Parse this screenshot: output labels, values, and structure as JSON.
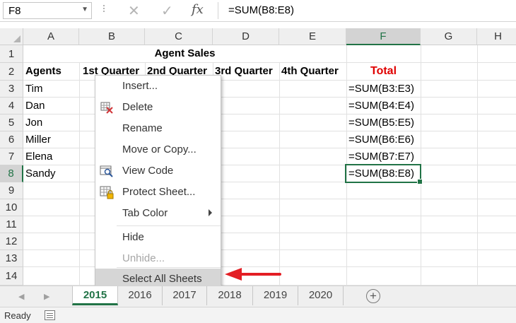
{
  "name_box": {
    "value": "F8"
  },
  "formula_bar": {
    "formula": "=SUM(B8:E8)",
    "fx_label": "fx",
    "cancel_glyph": "✕",
    "enter_glyph": "✓"
  },
  "columns": [
    "A",
    "B",
    "C",
    "D",
    "E",
    "F",
    "G",
    "H"
  ],
  "rows": [
    "1",
    "2",
    "3",
    "4",
    "5",
    "6",
    "7",
    "8",
    "9",
    "10",
    "11",
    "12",
    "13",
    "14"
  ],
  "cells": {
    "title": "Agent Sales",
    "headers": [
      "Agents",
      "1st Quarter",
      "2nd Quarter",
      "3rd Quarter",
      "4th Quarter",
      "Total"
    ],
    "agents": [
      "Tim",
      "Dan",
      "Jon",
      "Miller",
      "Elena",
      "Sandy"
    ],
    "totals": [
      "=SUM(B3:E3)",
      "=SUM(B4:E4)",
      "=SUM(B5:E5)",
      "=SUM(B6:E6)",
      "=SUM(B7:E7)",
      "=SUM(B8:E8)"
    ]
  },
  "context_menu": {
    "items": [
      {
        "label": "Insert...",
        "icon": null,
        "disabled": false
      },
      {
        "label": "Delete",
        "icon": "delete-sheet-icon",
        "disabled": false
      },
      {
        "label": "Rename",
        "icon": null,
        "disabled": false
      },
      {
        "label": "Move or Copy...",
        "icon": null,
        "disabled": false
      },
      {
        "label": "View Code",
        "icon": "view-code-icon",
        "disabled": false
      },
      {
        "label": "Protect Sheet...",
        "icon": "protect-sheet-icon",
        "disabled": false
      },
      {
        "label": "Tab Color",
        "icon": null,
        "disabled": false,
        "submenu": true
      },
      {
        "label": "Hide",
        "icon": null,
        "disabled": false
      },
      {
        "label": "Unhide...",
        "icon": null,
        "disabled": true
      },
      {
        "label": "Select All Sheets",
        "icon": null,
        "disabled": false,
        "highlighted": true
      }
    ]
  },
  "sheet_tabs": {
    "tabs": [
      "2015",
      "2016",
      "2017",
      "2018",
      "2019",
      "2020"
    ],
    "active": "2015",
    "add_glyph": "+"
  },
  "status_bar": {
    "text": "Ready"
  },
  "colors": {
    "accent": "#217346",
    "total_red": "#e00000",
    "arrow_red": "#e31e24"
  }
}
